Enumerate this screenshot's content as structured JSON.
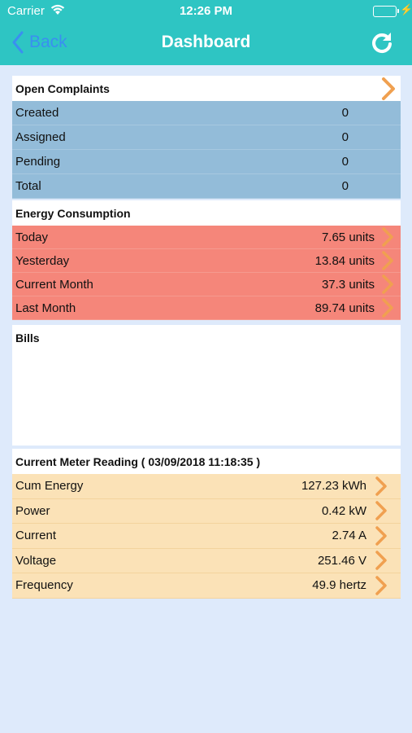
{
  "status_bar": {
    "carrier": "Carrier",
    "time": "12:26 PM"
  },
  "nav": {
    "back_label": "Back",
    "title": "Dashboard"
  },
  "complaints": {
    "title": "Open Complaints",
    "rows": [
      {
        "label": "Created",
        "value": "0"
      },
      {
        "label": "Assigned",
        "value": "0"
      },
      {
        "label": "Pending",
        "value": "0"
      },
      {
        "label": "Total",
        "value": "0"
      }
    ]
  },
  "energy": {
    "title": "Energy Consumption",
    "rows": [
      {
        "label": "Today",
        "value": "7.65 units"
      },
      {
        "label": "Yesterday",
        "value": "13.84 units"
      },
      {
        "label": "Current Month",
        "value": "37.3 units"
      },
      {
        "label": "Last Month",
        "value": "89.74 units"
      }
    ]
  },
  "bills": {
    "title": "Bills"
  },
  "meter": {
    "title": "Current Meter Reading ( 03/09/2018 11:18:35 )",
    "rows": [
      {
        "label": "Cum Energy",
        "value": "127.23 kWh"
      },
      {
        "label": "Power",
        "value": "0.42 kW"
      },
      {
        "label": "Current",
        "value": "2.74 A"
      },
      {
        "label": "Voltage",
        "value": "251.46 V"
      },
      {
        "label": "Frequency",
        "value": "49.9 hertz"
      }
    ]
  },
  "colors": {
    "nav": "#2ec5c3",
    "back": "#3a8ff0",
    "complaints_row": "#93bcd9",
    "energy_row": "#f5867a",
    "meter_row": "#fbe2b7",
    "chevron": "#f0a050",
    "background": "#deeafb"
  }
}
